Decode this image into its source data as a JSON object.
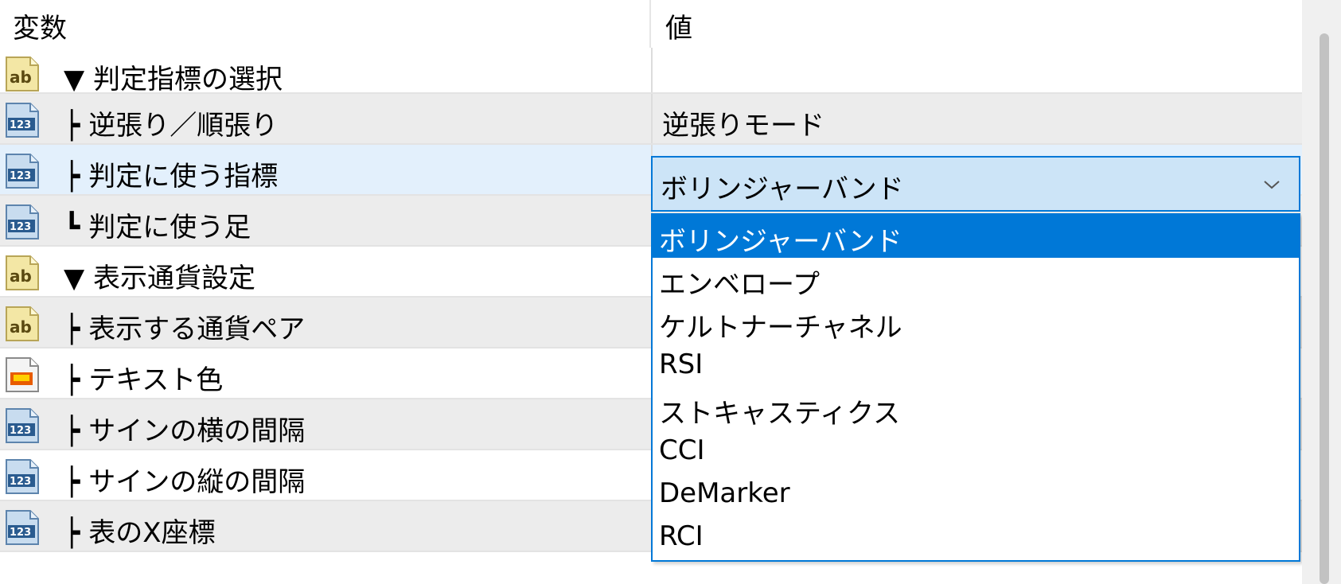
{
  "header": {
    "col_variable": "変数",
    "col_value": "値"
  },
  "rows": [
    {
      "icon": "ab-text-icon",
      "label": "▼ 判定指標の選択",
      "value": ""
    },
    {
      "icon": "123-number-icon",
      "label": "┝ 逆張り／順張り",
      "value": "逆張りモード"
    },
    {
      "icon": "123-number-icon",
      "label": "┝ 判定に使う指標",
      "value": ""
    },
    {
      "icon": "123-number-icon",
      "label": "┗ 判定に使う足",
      "value": ""
    },
    {
      "icon": "ab-text-icon",
      "label": "▼ 表示通貨設定",
      "value": ""
    },
    {
      "icon": "ab-text-icon",
      "label": "┝ 表示する通貨ペア",
      "value": ""
    },
    {
      "icon": "color-icon",
      "label": "┝ テキスト色",
      "value": ""
    },
    {
      "icon": "123-number-icon",
      "label": "┝ サインの横の間隔",
      "value": ""
    },
    {
      "icon": "123-number-icon",
      "label": "┝ サインの縦の間隔",
      "value": ""
    },
    {
      "icon": "123-number-icon",
      "label": "┝ 表のX座標",
      "value": ""
    }
  ],
  "combo": {
    "selected": "ボリンジャーバンド",
    "options": [
      "ボリンジャーバンド",
      "エンベロープ",
      "ケルトナーチャネル",
      "RSI",
      "ストキャスティクス",
      "CCI",
      "DeMarker",
      "RCI"
    ]
  },
  "colors": {
    "accent": "#0078d7",
    "selected_row": "#e3f0fc",
    "combo_bg": "#cce4f7",
    "shaded_row": "#ececec"
  }
}
